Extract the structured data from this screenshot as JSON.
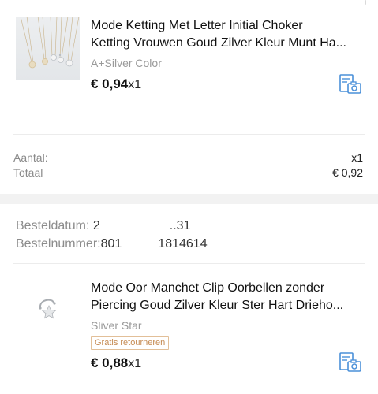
{
  "item1": {
    "title_line1": "Mode Ketting Met Letter Initial Choker",
    "title_line2": "Ketting Vrouwen Goud Zilver Kleur Munt Ha...",
    "variant": "A+Silver Color",
    "price": "€ 0,94",
    "qty": "x1",
    "image_icon": "necklace-product-image",
    "snapshot_icon": "snapshot-icon"
  },
  "summary": {
    "quantity_label": "Aantal:",
    "quantity_value": "x1",
    "total_label": "Totaal",
    "total_value": "€ 0,92"
  },
  "order": {
    "date_label": "Besteldatum:",
    "date_value": "2",
    "date_value_tail": "..31",
    "number_label": "Bestelnummer:",
    "number_value": "801",
    "number_value_tail": "1814614"
  },
  "item2": {
    "title_line1": "Mode Oor Manchet Clip Oorbellen zonder",
    "title_line2": "Piercing Goud Zilver Kleur Ster Hart Drieho...",
    "variant": "Sliver Star",
    "badge": "Gratis retourneren",
    "price": "€ 0,88",
    "qty": "x1",
    "image_icon": "ear-cuff-product-image",
    "snapshot_icon": "snapshot-icon"
  },
  "colors": {
    "accent_icon": "#4a90d9",
    "badge_text": "#c58a52",
    "divider_band": "#f2f2f2"
  }
}
